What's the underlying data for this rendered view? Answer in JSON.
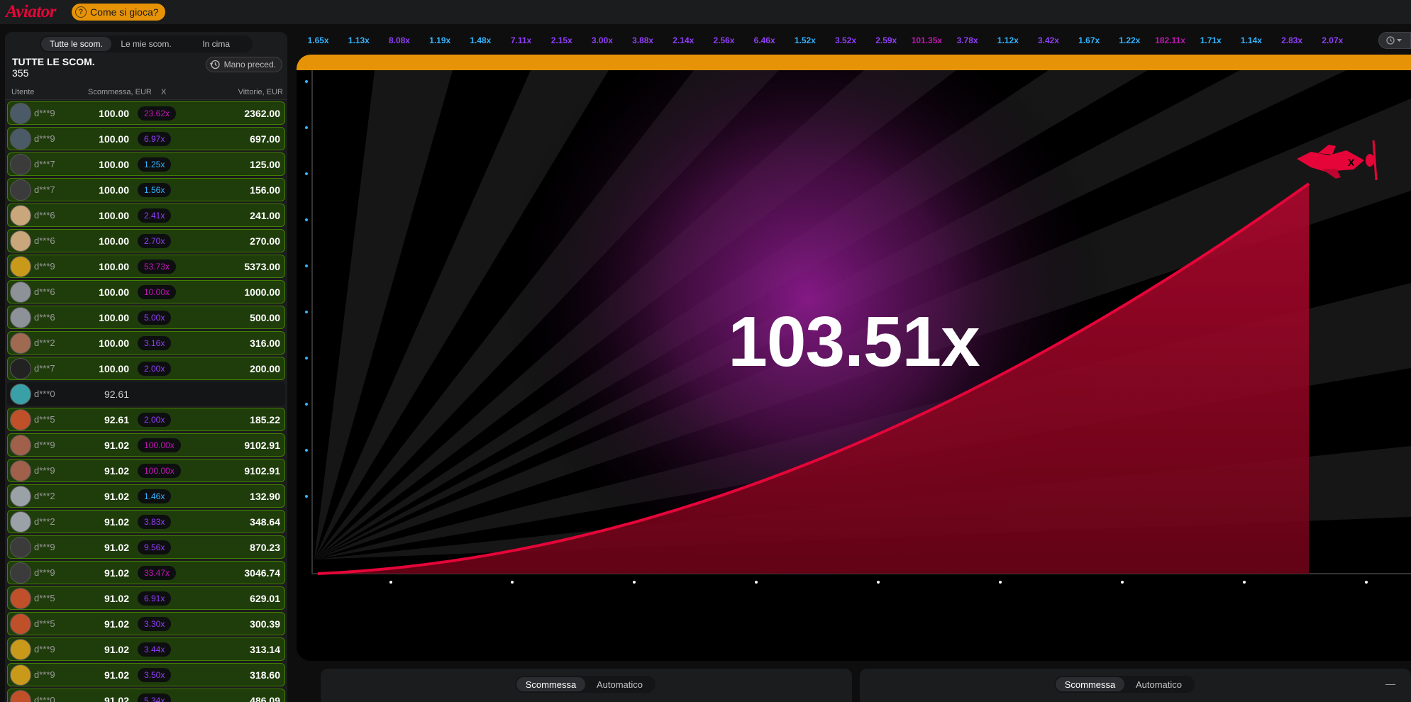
{
  "header": {
    "logo": "Aviator",
    "how_to_play": "Come si gioca?"
  },
  "left_panel": {
    "tabs": [
      "Tutte le scom.",
      "Le mie scom.",
      "In cima"
    ],
    "active_tab": 0,
    "summary_title": "TUTTE LE SCOM.",
    "summary_count": "355",
    "prev_hand_label": "Mano preced.",
    "columns": [
      "Utente",
      "Scommessa, EUR",
      "X",
      "Vittorie, EUR"
    ],
    "bets": [
      {
        "user": "d***9",
        "bet": "100.00",
        "mult": "23.62x",
        "win": "2362.00",
        "mult_color": "pink",
        "status": "win",
        "avatar_color": "#4a5a66"
      },
      {
        "user": "d***9",
        "bet": "100.00",
        "mult": "6.97x",
        "win": "697.00",
        "mult_color": "purple",
        "status": "win",
        "avatar_color": "#4a5a66"
      },
      {
        "user": "d***7",
        "bet": "100.00",
        "mult": "1.25x",
        "win": "125.00",
        "mult_color": "blue",
        "status": "win",
        "avatar_color": "#3b3b3b"
      },
      {
        "user": "d***7",
        "bet": "100.00",
        "mult": "1.56x",
        "win": "156.00",
        "mult_color": "blue",
        "status": "win",
        "avatar_color": "#3b3b3b"
      },
      {
        "user": "d***6",
        "bet": "100.00",
        "mult": "2.41x",
        "win": "241.00",
        "mult_color": "purple",
        "status": "win",
        "avatar_color": "#c9a77a"
      },
      {
        "user": "d***6",
        "bet": "100.00",
        "mult": "2.70x",
        "win": "270.00",
        "mult_color": "purple",
        "status": "win",
        "avatar_color": "#c9a77a"
      },
      {
        "user": "d***9",
        "bet": "100.00",
        "mult": "53.73x",
        "win": "5373.00",
        "mult_color": "pink",
        "status": "win",
        "avatar_color": "#c99a1a"
      },
      {
        "user": "d***6",
        "bet": "100.00",
        "mult": "10.00x",
        "win": "1000.00",
        "mult_color": "pink",
        "status": "win",
        "avatar_color": "#8c9297"
      },
      {
        "user": "d***6",
        "bet": "100.00",
        "mult": "5.00x",
        "win": "500.00",
        "mult_color": "purple",
        "status": "win",
        "avatar_color": "#8c9297"
      },
      {
        "user": "d***2",
        "bet": "100.00",
        "mult": "3.16x",
        "win": "316.00",
        "mult_color": "purple",
        "status": "win",
        "avatar_color": "#a06a50"
      },
      {
        "user": "d***7",
        "bet": "100.00",
        "mult": "2.00x",
        "win": "200.00",
        "mult_color": "purple",
        "status": "win",
        "avatar_color": "#222222"
      },
      {
        "user": "d***0",
        "bet": "92.61",
        "mult": "",
        "win": "",
        "mult_color": "",
        "status": "plain",
        "avatar_color": "#3aa0a8"
      },
      {
        "user": "d***5",
        "bet": "92.61",
        "mult": "2.00x",
        "win": "185.22",
        "mult_color": "purple",
        "status": "win",
        "avatar_color": "#c0502a"
      },
      {
        "user": "d***9",
        "bet": "91.02",
        "mult": "100.00x",
        "win": "9102.91",
        "mult_color": "pink",
        "status": "win",
        "avatar_color": "#a0604a"
      },
      {
        "user": "d***9",
        "bet": "91.02",
        "mult": "100.00x",
        "win": "9102.91",
        "mult_color": "pink",
        "status": "win",
        "avatar_color": "#a0604a"
      },
      {
        "user": "d***2",
        "bet": "91.02",
        "mult": "1.46x",
        "win": "132.90",
        "mult_color": "blue",
        "status": "win",
        "avatar_color": "#9aa2a8"
      },
      {
        "user": "d***2",
        "bet": "91.02",
        "mult": "3.83x",
        "win": "348.64",
        "mult_color": "purple",
        "status": "win",
        "avatar_color": "#9aa2a8"
      },
      {
        "user": "d***9",
        "bet": "91.02",
        "mult": "9.56x",
        "win": "870.23",
        "mult_color": "purple",
        "status": "win",
        "avatar_color": "#3b3b3b"
      },
      {
        "user": "d***9",
        "bet": "91.02",
        "mult": "33.47x",
        "win": "3046.74",
        "mult_color": "pink",
        "status": "win",
        "avatar_color": "#3b3b3b"
      },
      {
        "user": "d***5",
        "bet": "91.02",
        "mult": "6.91x",
        "win": "629.01",
        "mult_color": "purple",
        "status": "win",
        "avatar_color": "#c0502a"
      },
      {
        "user": "d***5",
        "bet": "91.02",
        "mult": "3.30x",
        "win": "300.39",
        "mult_color": "purple",
        "status": "win",
        "avatar_color": "#c0502a"
      },
      {
        "user": "d***9",
        "bet": "91.02",
        "mult": "3.44x",
        "win": "313.14",
        "mult_color": "purple",
        "status": "win",
        "avatar_color": "#c99a1a"
      },
      {
        "user": "d***9",
        "bet": "91.02",
        "mult": "3.50x",
        "win": "318.60",
        "mult_color": "purple",
        "status": "win",
        "avatar_color": "#c99a1a"
      },
      {
        "user": "d***0",
        "bet": "91.02",
        "mult": "5.34x",
        "win": "486.09",
        "mult_color": "purple",
        "status": "win",
        "avatar_color": "#c0502a"
      }
    ]
  },
  "history": [
    {
      "v": "1.65x",
      "c": "blue"
    },
    {
      "v": "1.13x",
      "c": "blue"
    },
    {
      "v": "8.08x",
      "c": "purple"
    },
    {
      "v": "1.19x",
      "c": "blue"
    },
    {
      "v": "1.48x",
      "c": "blue"
    },
    {
      "v": "7.11x",
      "c": "purple"
    },
    {
      "v": "2.15x",
      "c": "purple"
    },
    {
      "v": "3.00x",
      "c": "purple"
    },
    {
      "v": "3.88x",
      "c": "purple"
    },
    {
      "v": "2.14x",
      "c": "purple"
    },
    {
      "v": "2.56x",
      "c": "purple"
    },
    {
      "v": "6.46x",
      "c": "purple"
    },
    {
      "v": "1.52x",
      "c": "blue"
    },
    {
      "v": "3.52x",
      "c": "purple"
    },
    {
      "v": "2.59x",
      "c": "purple"
    },
    {
      "v": "101.35x",
      "c": "pink"
    },
    {
      "v": "3.78x",
      "c": "purple"
    },
    {
      "v": "1.12x",
      "c": "blue"
    },
    {
      "v": "3.42x",
      "c": "purple"
    },
    {
      "v": "1.67x",
      "c": "blue"
    },
    {
      "v": "1.22x",
      "c": "blue"
    },
    {
      "v": "182.11x",
      "c": "pink"
    },
    {
      "v": "1.71x",
      "c": "blue"
    },
    {
      "v": "1.14x",
      "c": "blue"
    },
    {
      "v": "2.83x",
      "c": "purple"
    },
    {
      "v": "2.07x",
      "c": "purple"
    }
  ],
  "game": {
    "multiplier": "103.51x"
  },
  "bet_panels": [
    {
      "tabs": [
        "Scommessa",
        "Automatico"
      ],
      "active_tab": 0
    },
    {
      "tabs": [
        "Scommessa",
        "Automatico"
      ],
      "active_tab": 0,
      "minimize": "—"
    }
  ],
  "colors": {
    "blue": "#34b4ff",
    "purple": "#913ef8",
    "pink": "#c017b4",
    "brand_red": "#e50539",
    "accent_orange": "#e69308",
    "win_green": "#427f00"
  },
  "icons": {
    "history_button": "clock-chevron-icon",
    "prev_hand": "clock-icon",
    "plane": "plane-icon"
  }
}
